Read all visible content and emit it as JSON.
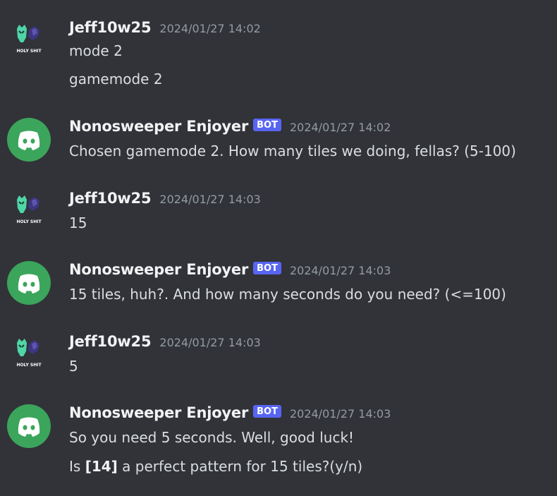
{
  "messages": [
    {
      "author": "Jeff10w25",
      "avatar_icon": "anime-skull-avatar-icon",
      "avatar_caption": "HOLY SHIT",
      "timestamp": "2024/01/27 14:02",
      "lines": [
        "mode 2",
        "gamemode 2"
      ]
    },
    {
      "author": "Nonosweeper Enjoyer",
      "badge": "BOT",
      "avatar_icon": "discord-logo-icon",
      "timestamp": "2024/01/27 14:02",
      "lines": [
        "Chosen gamemode 2. How many tiles we doing, fellas? (5-100)"
      ]
    },
    {
      "author": "Jeff10w25",
      "avatar_icon": "anime-skull-avatar-icon",
      "avatar_caption": "HOLY SHIT",
      "timestamp": "2024/01/27 14:03",
      "lines": [
        "15"
      ]
    },
    {
      "author": "Nonosweeper Enjoyer",
      "badge": "BOT",
      "avatar_icon": "discord-logo-icon",
      "timestamp": "2024/01/27 14:03",
      "lines": [
        "15 tiles, huh?. And how many seconds do you need? (<=100)"
      ]
    },
    {
      "author": "Jeff10w25",
      "avatar_icon": "anime-skull-avatar-icon",
      "avatar_caption": "HOLY SHIT",
      "timestamp": "2024/01/27 14:03",
      "lines": [
        "5"
      ]
    },
    {
      "author": "Nonosweeper Enjoyer",
      "badge": "BOT",
      "avatar_icon": "discord-logo-icon",
      "timestamp": "2024/01/27 14:03",
      "lines": [
        "So you need 5 seconds. Well, good luck!"
      ],
      "question": {
        "before": "Is ",
        "bold": "[14]",
        "after": " a perfect pattern for 15 tiles?(y/n)"
      }
    }
  ],
  "colors": {
    "background": "#313338",
    "username": "#f2f3f5",
    "message_text": "#dbdee1",
    "timestamp": "#949ba4",
    "bot_badge": "#5865f2",
    "bot_avatar": "#3ba55c"
  }
}
